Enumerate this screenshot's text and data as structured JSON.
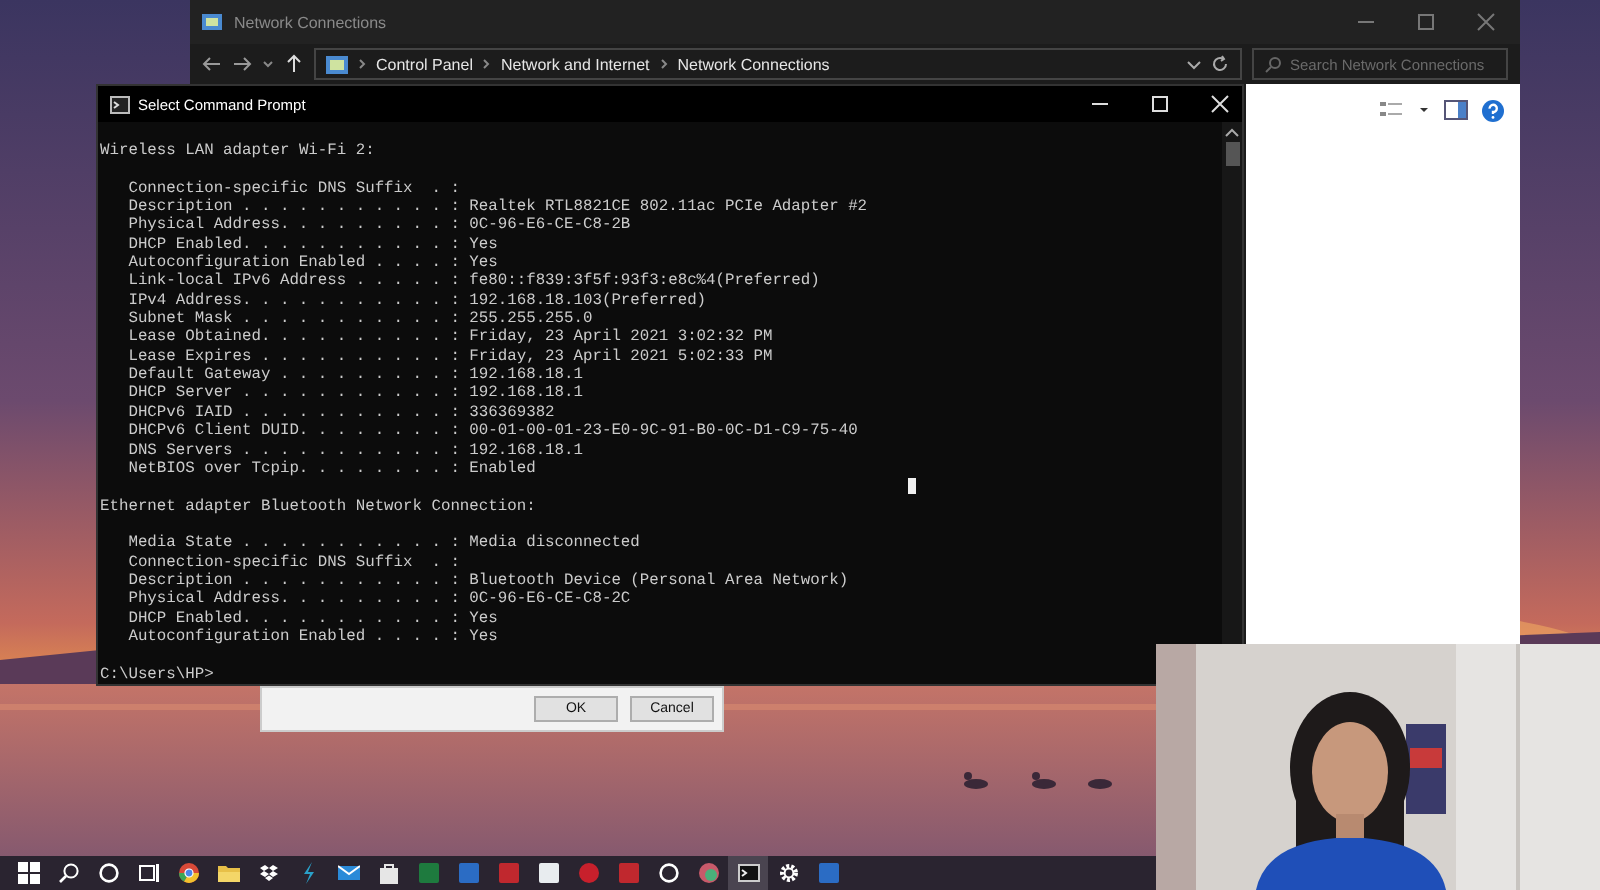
{
  "explorer": {
    "title": "Network Connections",
    "breadcrumb": [
      "Control Panel",
      "Network and Internet",
      "Network Connections"
    ],
    "search": {
      "placeholder": "Search Network Connections"
    }
  },
  "command_prompt": {
    "title": "Select Command Prompt",
    "sections": [
      {
        "heading": "Wireless LAN adapter Wi-Fi 2:",
        "entries": [
          "Connection-specific DNS Suffix  . :",
          "Description . . . . . . . . . . . : Realtek RTL8821CE 802.11ac PCIe Adapter #2",
          "Physical Address. . . . . . . . . : 0C-96-E6-CE-C8-2B",
          "DHCP Enabled. . . . . . . . . . . : Yes",
          "Autoconfiguration Enabled . . . . : Yes",
          "Link-local IPv6 Address . . . . . : fe80::f839:3f5f:93f3:e8c%4(Preferred)",
          "IPv4 Address. . . . . . . . . . . : 192.168.18.103(Preferred)",
          "Subnet Mask . . . . . . . . . . . : 255.255.255.0",
          "Lease Obtained. . . . . . . . . . : Friday, 23 April 2021 3:02:32 PM",
          "Lease Expires . . . . . . . . . . : Friday, 23 April 2021 5:02:33 PM",
          "Default Gateway . . . . . . . . . : 192.168.18.1",
          "DHCP Server . . . . . . . . . . . : 192.168.18.1",
          "DHCPv6 IAID . . . . . . . . . . . : 336369382",
          "DHCPv6 Client DUID. . . . . . . . : 00-01-00-01-23-E0-9C-91-B0-0C-D1-C9-75-40",
          "DNS Servers . . . . . . . . . . . : 192.168.18.1",
          "NetBIOS over Tcpip. . . . . . . . : Enabled"
        ]
      },
      {
        "heading": "Ethernet adapter Bluetooth Network Connection:",
        "entries": [
          "Media State . . . . . . . . . . . : Media disconnected",
          "Connection-specific DNS Suffix  . :",
          "Description . . . . . . . . . . . : Bluetooth Device (Personal Area Network)",
          "Physical Address. . . . . . . . . : 0C-96-E6-CE-C8-2C",
          "DHCP Enabled. . . . . . . . . . . : Yes",
          "Autoconfiguration Enabled . . . . : Yes"
        ]
      }
    ],
    "prompt": "C:\\Users\\HP>"
  },
  "dialog": {
    "buttons": [
      "OK",
      "Cancel"
    ]
  },
  "taskbar": {
    "items": [
      {
        "kind": "windows",
        "selected": false
      },
      {
        "kind": "search",
        "selected": false
      },
      {
        "kind": "ring",
        "selected": false
      },
      {
        "kind": "taskview",
        "selected": false
      },
      {
        "kind": "browser",
        "selected": false
      },
      {
        "kind": "folder",
        "selected": false
      },
      {
        "kind": "box",
        "selected": false
      },
      {
        "kind": "bolt",
        "selected": false
      },
      {
        "kind": "mail",
        "selected": false
      },
      {
        "kind": "bag",
        "selected": false
      },
      {
        "kind": "green-tile",
        "selected": false
      },
      {
        "kind": "blue-tile",
        "selected": false
      },
      {
        "kind": "red-tile",
        "selected": false
      },
      {
        "kind": "white-tile",
        "selected": false
      },
      {
        "kind": "red-circle",
        "selected": false
      },
      {
        "kind": "red-tile",
        "selected": false
      },
      {
        "kind": "ring",
        "selected": false
      },
      {
        "kind": "orb",
        "selected": false
      },
      {
        "kind": "terminal",
        "selected": true
      },
      {
        "kind": "gear",
        "selected": false
      },
      {
        "kind": "blue-tile",
        "selected": false
      }
    ]
  }
}
